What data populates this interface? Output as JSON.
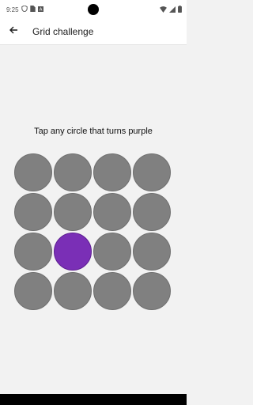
{
  "status_bar": {
    "time": "9:25",
    "icons": [
      "shield-icon",
      "sim-icon",
      "a-icon",
      "wifi-icon",
      "signal-icon",
      "battery-icon"
    ]
  },
  "app_bar": {
    "title": "Grid challenge",
    "back_icon": "arrow-back-icon"
  },
  "instruction": "Tap any circle that turns purple",
  "grid": {
    "rows": 4,
    "cols": 4,
    "active_cell": {
      "row": 3,
      "col": 2
    },
    "colors": {
      "inactive": "#808080",
      "active": "#7a2fb6"
    }
  }
}
